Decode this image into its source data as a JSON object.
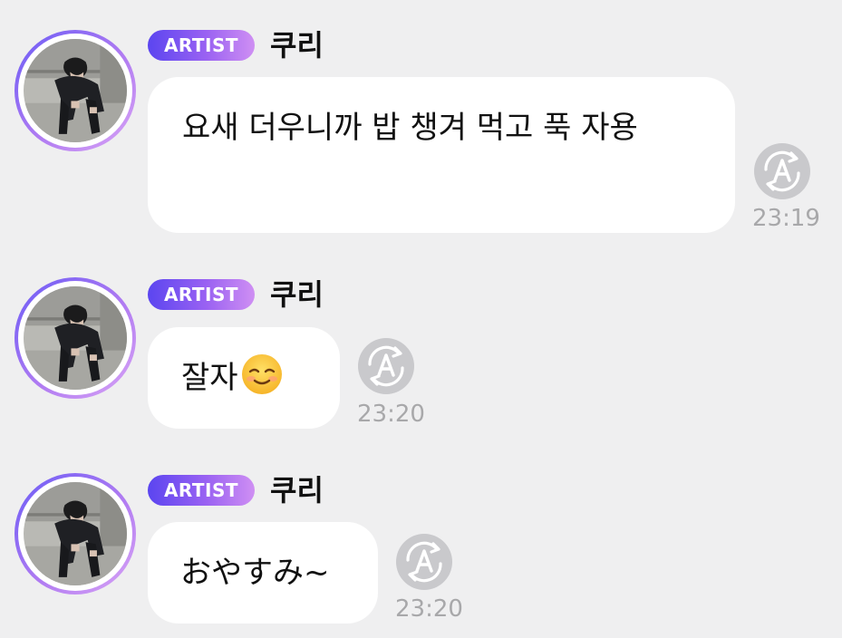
{
  "messages": [
    {
      "badge": "ARTIST",
      "sender": "쿠리",
      "text": "요새 더우니까 밥 챙겨 먹고 푹 자용",
      "time": "23:19",
      "translate_icon": "translate-icon"
    },
    {
      "badge": "ARTIST",
      "sender": "쿠리",
      "text": "잘자",
      "emoji": "smiling-face-emoji",
      "time": "23:20",
      "translate_icon": "translate-icon"
    },
    {
      "badge": "ARTIST",
      "sender": "쿠리",
      "text": "おやすみ~",
      "time": "23:20",
      "translate_icon": "translate-icon"
    }
  ],
  "colors": {
    "background": "#efeff0",
    "bubble": "#ffffff",
    "badge_gradient_start": "#5b45f0",
    "badge_gradient_end": "#cf8ff3",
    "timestamp": "#a8a8aa",
    "translate_icon": "#c9c9cc"
  }
}
